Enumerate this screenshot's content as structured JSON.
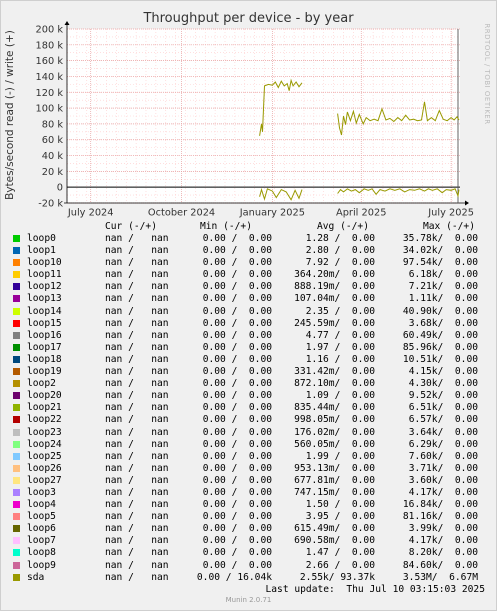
{
  "title": "Throughput per device - by year",
  "ylabel": "Bytes/second read (-) / write (+)",
  "watermark": "RRDTOOL / TOBI OETIKER",
  "legend_header": {
    "cur": "Cur (-/+)",
    "min": "Min (-/+)",
    "avg": "Avg (-/+)",
    "max": "Max (-/+)"
  },
  "last_update": "Last update:  Thu Jul 10 03:15:03 2025",
  "munin_version": "Munin 2.0.71",
  "chart_data": {
    "type": "line",
    "title": "Throughput per device - by year",
    "ylabel": "Bytes/second read (-) / write (+)",
    "ylim": [
      -20000,
      200000
    ],
    "yticks": [
      {
        "v": 200000,
        "label": "200 k"
      },
      {
        "v": 180000,
        "label": "180 k"
      },
      {
        "v": 160000,
        "label": "160 k"
      },
      {
        "v": 140000,
        "label": "140 k"
      },
      {
        "v": 120000,
        "label": "120 k"
      },
      {
        "v": 100000,
        "label": "100 k"
      },
      {
        "v": 80000,
        "label": "80 k"
      },
      {
        "v": 60000,
        "label": "60 k"
      },
      {
        "v": 40000,
        "label": "40 k"
      },
      {
        "v": 20000,
        "label": "20 k"
      },
      {
        "v": 0,
        "label": "0"
      },
      {
        "v": -20000,
        "label": "-20 k"
      }
    ],
    "xticks": [
      {
        "date": "2024-07-01",
        "label": "July 2024"
      },
      {
        "date": "2024-10-01",
        "label": "October 2024"
      },
      {
        "date": "2025-01-01",
        "label": "January 2025"
      },
      {
        "date": "2025-04-01",
        "label": "April 2025"
      },
      {
        "date": "2025-07-01",
        "label": "July 2025"
      }
    ],
    "xrange": [
      "2024-06-07",
      "2025-07-10"
    ],
    "grid": true,
    "series": [
      {
        "name": "sda",
        "color": "#999900",
        "segments": [
          {
            "write": [
              [
                "2024-12-19",
                65000
              ],
              [
                "2024-12-21",
                80000
              ],
              [
                "2024-12-22",
                70000
              ],
              [
                "2024-12-24",
                128000
              ],
              [
                "2024-12-28",
                130000
              ],
              [
                "2025-01-01",
                129000
              ],
              [
                "2025-01-04",
                133000
              ],
              [
                "2025-01-07",
                126000
              ],
              [
                "2025-01-10",
                134000
              ],
              [
                "2025-01-13",
                128000
              ],
              [
                "2025-01-16",
                131000
              ],
              [
                "2025-01-18",
                122000
              ],
              [
                "2025-01-20",
                135000
              ],
              [
                "2025-01-22",
                128000
              ],
              [
                "2025-01-25",
                133000
              ],
              [
                "2025-01-28",
                127000
              ],
              [
                "2025-01-31",
                132000
              ]
            ],
            "read": [
              [
                "2024-12-19",
                -12000
              ],
              [
                "2024-12-21",
                -3000
              ],
              [
                "2024-12-24",
                -15000
              ],
              [
                "2024-12-27",
                -2000
              ],
              [
                "2025-01-01",
                -5000
              ],
              [
                "2025-01-05",
                -13000
              ],
              [
                "2025-01-10",
                -3000
              ],
              [
                "2025-01-15",
                -6000
              ],
              [
                "2025-01-20",
                -16000
              ],
              [
                "2025-01-24",
                -4000
              ],
              [
                "2025-01-28",
                -14000
              ],
              [
                "2025-01-31",
                -3000
              ]
            ]
          },
          {
            "write": [
              [
                "2025-03-08",
                93000
              ],
              [
                "2025-03-10",
                75000
              ],
              [
                "2025-03-12",
                66000
              ],
              [
                "2025-03-14",
                90000
              ],
              [
                "2025-03-16",
                79000
              ],
              [
                "2025-03-18",
                95000
              ],
              [
                "2025-03-21",
                84000
              ],
              [
                "2025-03-24",
                96000
              ],
              [
                "2025-03-27",
                81000
              ],
              [
                "2025-03-30",
                92000
              ],
              [
                "2025-04-03",
                80000
              ],
              [
                "2025-04-06",
                88000
              ],
              [
                "2025-04-10",
                84000
              ],
              [
                "2025-04-14",
                86000
              ],
              [
                "2025-04-18",
                84000
              ],
              [
                "2025-04-22",
                99000
              ],
              [
                "2025-04-26",
                85000
              ],
              [
                "2025-04-30",
                87000
              ],
              [
                "2025-05-04",
                83000
              ],
              [
                "2025-05-08",
                88000
              ],
              [
                "2025-05-12",
                84000
              ],
              [
                "2025-05-16",
                91000
              ],
              [
                "2025-05-20",
                85000
              ],
              [
                "2025-05-24",
                86000
              ],
              [
                "2025-05-28",
                84000
              ],
              [
                "2025-06-01",
                85000
              ],
              [
                "2025-06-04",
                108000
              ],
              [
                "2025-06-07",
                84000
              ],
              [
                "2025-06-11",
                88000
              ],
              [
                "2025-06-15",
                84000
              ],
              [
                "2025-06-19",
                97000
              ],
              [
                "2025-06-23",
                86000
              ],
              [
                "2025-06-27",
                84000
              ],
              [
                "2025-07-01",
                88000
              ],
              [
                "2025-07-04",
                85000
              ],
              [
                "2025-07-07",
                89000
              ],
              [
                "2025-07-09",
                85000
              ]
            ],
            "read": [
              [
                "2025-03-08",
                -8000
              ],
              [
                "2025-03-11",
                -3000
              ],
              [
                "2025-03-14",
                -6000
              ],
              [
                "2025-03-18",
                -2000
              ],
              [
                "2025-03-22",
                -5000
              ],
              [
                "2025-03-26",
                -3000
              ],
              [
                "2025-03-30",
                -7000
              ],
              [
                "2025-04-04",
                -2000
              ],
              [
                "2025-04-08",
                -4000
              ],
              [
                "2025-04-12",
                -2000
              ],
              [
                "2025-04-16",
                -9000
              ],
              [
                "2025-04-20",
                -3000
              ],
              [
                "2025-04-25",
                -5000
              ],
              [
                "2025-04-30",
                -2000
              ],
              [
                "2025-05-05",
                -4000
              ],
              [
                "2025-05-10",
                -2000
              ],
              [
                "2025-05-15",
                -6000
              ],
              [
                "2025-05-20",
                -3000
              ],
              [
                "2025-05-25",
                -4000
              ],
              [
                "2025-05-30",
                -2000
              ],
              [
                "2025-06-04",
                -5000
              ],
              [
                "2025-06-08",
                -2000
              ],
              [
                "2025-06-12",
                -4000
              ],
              [
                "2025-06-17",
                -2000
              ],
              [
                "2025-06-22",
                -7000
              ],
              [
                "2025-06-26",
                -3000
              ],
              [
                "2025-07-01",
                -4000
              ],
              [
                "2025-07-05",
                -2000
              ],
              [
                "2025-07-08",
                -11000
              ],
              [
                "2025-07-09",
                -3000
              ]
            ]
          }
        ]
      }
    ]
  },
  "legend": [
    {
      "name": "loop0",
      "color": "#00cc00",
      "cur": "nan /   nan",
      "min": "0.00 /  0.00",
      "avg": "1.28 /  0.00",
      "max": "35.78k/  0.00"
    },
    {
      "name": "loop1",
      "color": "#0066b3",
      "cur": "nan /   nan",
      "min": "0.00 /  0.00",
      "avg": "2.80 /  0.00",
      "max": "34.02k/  0.00"
    },
    {
      "name": "loop10",
      "color": "#ff8000",
      "cur": "nan /   nan",
      "min": "0.00 /  0.00",
      "avg": "7.92 /  0.00",
      "max": "97.54k/  0.00"
    },
    {
      "name": "loop11",
      "color": "#ffcc00",
      "cur": "nan /   nan",
      "min": "0.00 /  0.00",
      "avg": "364.20m/  0.00",
      "max": "6.18k/  0.00"
    },
    {
      "name": "loop12",
      "color": "#330099",
      "cur": "nan /   nan",
      "min": "0.00 /  0.00",
      "avg": "888.19m/  0.00",
      "max": "7.21k/  0.00"
    },
    {
      "name": "loop13",
      "color": "#990099",
      "cur": "nan /   nan",
      "min": "0.00 /  0.00",
      "avg": "107.04m/  0.00",
      "max": "1.11k/  0.00"
    },
    {
      "name": "loop14",
      "color": "#ccff00",
      "cur": "nan /   nan",
      "min": "0.00 /  0.00",
      "avg": "2.35 /  0.00",
      "max": "40.90k/  0.00"
    },
    {
      "name": "loop15",
      "color": "#ff0000",
      "cur": "nan /   nan",
      "min": "0.00 /  0.00",
      "avg": "245.59m/  0.00",
      "max": "3.68k/  0.00"
    },
    {
      "name": "loop16",
      "color": "#808080",
      "cur": "nan /   nan",
      "min": "0.00 /  0.00",
      "avg": "4.77 /  0.00",
      "max": "60.49k/  0.00"
    },
    {
      "name": "loop17",
      "color": "#008f00",
      "cur": "nan /   nan",
      "min": "0.00 /  0.00",
      "avg": "1.97 /  0.00",
      "max": "85.96k/  0.00"
    },
    {
      "name": "loop18",
      "color": "#00487d",
      "cur": "nan /   nan",
      "min": "0.00 /  0.00",
      "avg": "1.16 /  0.00",
      "max": "10.51k/  0.00"
    },
    {
      "name": "loop19",
      "color": "#b35a00",
      "cur": "nan /   nan",
      "min": "0.00 /  0.00",
      "avg": "331.42m/  0.00",
      "max": "4.15k/  0.00"
    },
    {
      "name": "loop2",
      "color": "#b38f00",
      "cur": "nan /   nan",
      "min": "0.00 /  0.00",
      "avg": "872.10m/  0.00",
      "max": "4.30k/  0.00"
    },
    {
      "name": "loop20",
      "color": "#6b006b",
      "cur": "nan /   nan",
      "min": "0.00 /  0.00",
      "avg": "1.09 /  0.00",
      "max": "9.52k/  0.00"
    },
    {
      "name": "loop21",
      "color": "#8fb300",
      "cur": "nan /   nan",
      "min": "0.00 /  0.00",
      "avg": "835.44m/  0.00",
      "max": "6.51k/  0.00"
    },
    {
      "name": "loop22",
      "color": "#b30000",
      "cur": "nan /   nan",
      "min": "0.00 /  0.00",
      "avg": "998.05m/  0.00",
      "max": "6.57k/  0.00"
    },
    {
      "name": "loop23",
      "color": "#bebebe",
      "cur": "nan /   nan",
      "min": "0.00 /  0.00",
      "avg": "176.02m/  0.00",
      "max": "3.64k/  0.00"
    },
    {
      "name": "loop24",
      "color": "#80ff80",
      "cur": "nan /   nan",
      "min": "0.00 /  0.00",
      "avg": "560.05m/  0.00",
      "max": "6.29k/  0.00"
    },
    {
      "name": "loop25",
      "color": "#80c9ff",
      "cur": "nan /   nan",
      "min": "0.00 /  0.00",
      "avg": "1.99 /  0.00",
      "max": "7.60k/  0.00"
    },
    {
      "name": "loop26",
      "color": "#ffc080",
      "cur": "nan /   nan",
      "min": "0.00 /  0.00",
      "avg": "953.13m/  0.00",
      "max": "3.71k/  0.00"
    },
    {
      "name": "loop27",
      "color": "#ffe680",
      "cur": "nan /   nan",
      "min": "0.00 /  0.00",
      "avg": "677.81m/  0.00",
      "max": "3.60k/  0.00"
    },
    {
      "name": "loop3",
      "color": "#aa80ff",
      "cur": "nan /   nan",
      "min": "0.00 /  0.00",
      "avg": "747.15m/  0.00",
      "max": "4.17k/  0.00"
    },
    {
      "name": "loop4",
      "color": "#ee00cc",
      "cur": "nan /   nan",
      "min": "0.00 /  0.00",
      "avg": "1.50 /  0.00",
      "max": "16.84k/  0.00"
    },
    {
      "name": "loop5",
      "color": "#ff8080",
      "cur": "nan /   nan",
      "min": "0.00 /  0.00",
      "avg": "3.95 /  0.00",
      "max": "81.16k/  0.00"
    },
    {
      "name": "loop6",
      "color": "#666600",
      "cur": "nan /   nan",
      "min": "0.00 /  0.00",
      "avg": "615.49m/  0.00",
      "max": "3.99k/  0.00"
    },
    {
      "name": "loop7",
      "color": "#ffbfff",
      "cur": "nan /   nan",
      "min": "0.00 /  0.00",
      "avg": "690.58m/  0.00",
      "max": "4.17k/  0.00"
    },
    {
      "name": "loop8",
      "color": "#00ffcc",
      "cur": "nan /   nan",
      "min": "0.00 /  0.00",
      "avg": "1.47 /  0.00",
      "max": "8.20k/  0.00"
    },
    {
      "name": "loop9",
      "color": "#cc6699",
      "cur": "nan /   nan",
      "min": "0.00 /  0.00",
      "avg": "2.66 /  0.00",
      "max": "84.60k/  0.00"
    },
    {
      "name": "sda",
      "color": "#999900",
      "cur": "nan /   nan",
      "min": "0.00 / 16.04k",
      "avg": "2.55k/ 93.37k",
      "max": "3.53M/  6.67M"
    }
  ]
}
